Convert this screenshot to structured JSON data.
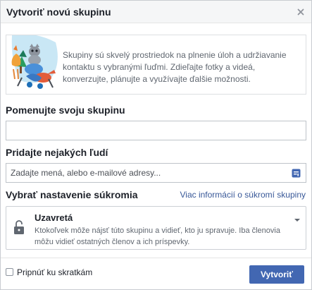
{
  "dialog": {
    "title": "Vytvoriť novú skupinu",
    "close_icon": "close-icon"
  },
  "intro": {
    "illustration": "group-animals-illustration",
    "text": "Skupiny sú skvelý prostriedok na plnenie úloh a udržiavanie kontaktu s vybranými ľuďmi. Zdieľajte fotky a videá, konverzujte, plánujte a využívajte ďalšie možnosti."
  },
  "name_section": {
    "label": "Pomenujte svoju skupinu",
    "value": "",
    "placeholder": ""
  },
  "people_section": {
    "label": "Pridajte nejakých ľudí",
    "value": "",
    "placeholder": "Zadajte mená, alebo e-mailové adresy...",
    "icon": "contact-card-icon"
  },
  "privacy_section": {
    "label": "Vybrať nastavenie súkromia",
    "link": "Viac informácií o súkromí skupiny",
    "selected_title": "Uzavretá",
    "selected_description": "Ktokoľvek môže nájsť túto skupinu a vidieť, kto ju spravuje. Iba členovia môžu vidieť ostatných členov a ich príspevky.",
    "icon": "lock-icon"
  },
  "footer": {
    "pin_label": "Pripnúť ku skratkám",
    "pin_checked": false,
    "create_label": "Vytvoriť"
  },
  "colors": {
    "primary": "#4267b2",
    "link": "#385898",
    "header_bg": "#f5f6f7",
    "border": "#dddfe2"
  }
}
